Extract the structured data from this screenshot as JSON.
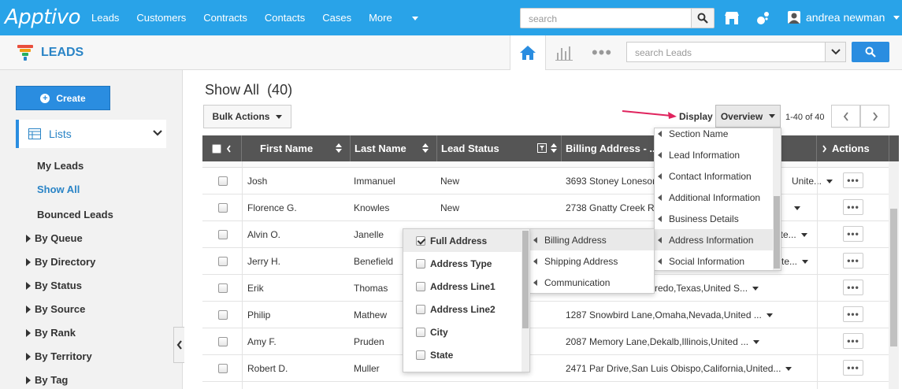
{
  "app": {
    "logo": "Apptivo",
    "nav": [
      "Leads",
      "Customers",
      "Contracts",
      "Contacts",
      "Cases"
    ],
    "nav_more": "More",
    "search_placeholder": "search",
    "user_name": "andrea newman"
  },
  "module": {
    "title": "LEADS",
    "search_placeholder": "search Leads",
    "more_dots": "•••"
  },
  "sidebar": {
    "create_label": "Create",
    "lists_label": "Lists",
    "items": [
      "My Leads",
      "Show All",
      "Bounced Leads"
    ],
    "active_item": "Show All",
    "groups": [
      "By Queue",
      "By Directory",
      "By Status",
      "By Source",
      "By Rank",
      "By Territory",
      "By Tag"
    ]
  },
  "main": {
    "title": "Show All",
    "count": "(40)",
    "bulk_label": "Bulk Actions",
    "display_label": "Display",
    "display_value": "Overview",
    "pager_text": "1-40 of 40"
  },
  "table": {
    "columns": [
      "First Name",
      "Last Name",
      "Lead Status",
      "Billing Address - ...",
      "Actions"
    ],
    "rows": [
      {
        "first": "Josh",
        "last": "Immanuel",
        "status": "New",
        "addr": "3693 Stoney Lonesome...",
        "addr_tail": "Unite..."
      },
      {
        "first": "Florence G.",
        "last": "Knowles",
        "status": "New",
        "addr": "2738 Gnatty Creek R",
        "addr_tail": ""
      },
      {
        "first": "Alvin O.",
        "last": "Janelle",
        "status": "",
        "addr": "",
        "addr_tail": "ite..."
      },
      {
        "first": "Jerry H.",
        "last": "Benefield",
        "status": "",
        "addr": "",
        "addr_tail": "te..."
      },
      {
        "first": "Erik",
        "last": "Thomas",
        "status": "",
        "addr": "",
        "addr_tail": "redo,Texas,United S..."
      },
      {
        "first": "Philip",
        "last": "Mathew",
        "status": "",
        "addr": "1287 Snowbird Lane,Omaha,Nevada,United ...",
        "addr_tail": ""
      },
      {
        "first": "Amy F.",
        "last": "Pruden",
        "status": "",
        "addr": "2087 Memory Lane,Dekalb,Illinois,United ...",
        "addr_tail": ""
      },
      {
        "first": "Robert D.",
        "last": "Muller",
        "status": "",
        "addr": "2471 Par Drive,San Luis Obispo,California,United...",
        "addr_tail": ""
      }
    ],
    "actions_label": "•••"
  },
  "display_menu": {
    "sections": [
      "Section Name",
      "Lead Information",
      "Contact Information",
      "Additional Information",
      "Business Details",
      "Address Information",
      "Social Information"
    ],
    "highlighted_section": "Address Information",
    "address_types": [
      "Billing Address",
      "Shipping Address",
      "Communication"
    ],
    "highlighted_type": "Billing Address",
    "fields": [
      {
        "label": "Full Address",
        "checked": true
      },
      {
        "label": "Address Type",
        "checked": false
      },
      {
        "label": "Address Line1",
        "checked": false
      },
      {
        "label": "Address Line2",
        "checked": false
      },
      {
        "label": "City",
        "checked": false
      },
      {
        "label": "State",
        "checked": false
      }
    ]
  },
  "colors": {
    "topbar": "#29a3e8",
    "accent": "#2a84c6",
    "header": "#555555",
    "arrow": "#e0245e"
  }
}
